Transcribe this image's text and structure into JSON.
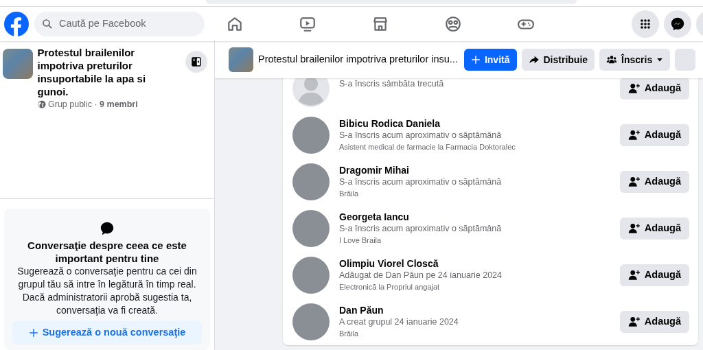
{
  "topbar": {
    "search": {
      "placeholder": "Caută pe Facebook"
    },
    "nav_icons": [
      {
        "kind": "home",
        "selected": false
      },
      {
        "kind": "video",
        "selected": false
      },
      {
        "kind": "marketplace",
        "selected": false
      },
      {
        "kind": "groups",
        "selected": false
      },
      {
        "kind": "gaming",
        "selected": false
      }
    ],
    "right_icons": [
      {
        "kind": "menu"
      },
      {
        "kind": "messenger"
      },
      {
        "kind": "cut"
      }
    ]
  },
  "sidebar": {
    "group": {
      "name": "Protestul brailenilor impotriva preturilor insuportabile la apa si gunoi.",
      "privacy": "Grup public",
      "separator": "·",
      "members": "9 membri"
    },
    "chat_card": {
      "title": "Conversaţie despre ceea ce este important pentru tine",
      "body": "Sugerează o conversaţie pentru ca cei din grupul tău să intre în legătură în timp real. Dacă administratorii aprobă sugestia ta, conversaţia va fi creată.",
      "button": "Sugerează o nouă conversaţie"
    }
  },
  "group_header": {
    "title": "Protestul brailenilor impotriva preturilor insu...",
    "buttons": [
      {
        "kind": "primary",
        "label": "Invită"
      },
      {
        "kind": "share",
        "label": "Distribuie"
      },
      {
        "kind": "joined",
        "label": "Înscris"
      },
      {
        "kind": "cut"
      }
    ]
  },
  "members": [
    {
      "kind": "silhouette",
      "subtitle": "S-a înscris sâmbăta trecută",
      "button": "Adaugă"
    },
    {
      "kind": "photo",
      "name": "Bibicu Rodica Daniela",
      "subtitle": "S-a înscris acum aproximativ o săptămână",
      "detail": "Asistent medical de farmacie la Farmacia Doktoralec",
      "button": "Adaugă"
    },
    {
      "kind": "photo",
      "name": "Dragomir Mihai",
      "subtitle": "S-a înscris acum aproximativ o săptămână",
      "detail": "Brăila",
      "button": "Adaugă"
    },
    {
      "kind": "photo",
      "name": "Georgeta Iancu",
      "subtitle": "S-a înscris acum aproximativ o săptămână",
      "detail": "I Love Braila",
      "button": "Adaugă"
    },
    {
      "kind": "photo",
      "name": "Olimpiu Viorel Closcă",
      "subtitle": "Adăugat de Dan Păun pe 24 ianuarie 2024",
      "detail": "Electronică la Propriul angajat",
      "button": "Adaugă"
    },
    {
      "kind": "photo",
      "name": "Dan Păun",
      "subtitle": "A creat grupul 24 ianuarie 2024",
      "detail": "Brăila",
      "button": "Adaugă"
    }
  ]
}
